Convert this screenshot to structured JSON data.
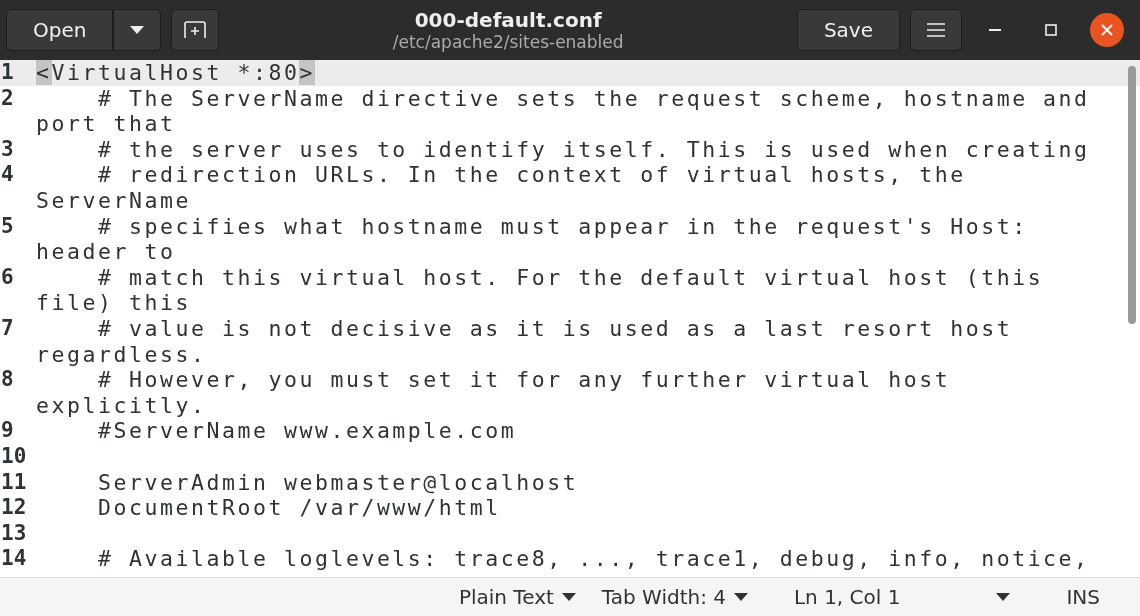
{
  "header_bar": {
    "open_button": "Open",
    "title": "000-default.conf",
    "subtitle": "/etc/apache2/sites-enabled",
    "save_button": "Save"
  },
  "editor": {
    "lines": [
      {
        "number": "1",
        "text": "<VirtualHost *:80>",
        "current": true,
        "bracket_match": true
      },
      {
        "number": "2",
        "text": "    # The ServerName directive sets the request scheme, hostname and port that",
        "current": false,
        "bracket_match": false
      },
      {
        "number": "3",
        "text": "    # the server uses to identify itself. This is used when creating",
        "current": false,
        "bracket_match": false
      },
      {
        "number": "4",
        "text": "    # redirection URLs. In the context of virtual hosts, the ServerName",
        "current": false,
        "bracket_match": false
      },
      {
        "number": "5",
        "text": "    # specifies what hostname must appear in the request's Host: header to",
        "current": false,
        "bracket_match": false
      },
      {
        "number": "6",
        "text": "    # match this virtual host. For the default virtual host (this file) this",
        "current": false,
        "bracket_match": false
      },
      {
        "number": "7",
        "text": "    # value is not decisive as it is used as a last resort host regardless.",
        "current": false,
        "bracket_match": false
      },
      {
        "number": "8",
        "text": "    # However, you must set it for any further virtual host explicitly.",
        "current": false,
        "bracket_match": false
      },
      {
        "number": "9",
        "text": "    #ServerName www.example.com",
        "current": false,
        "bracket_match": false
      },
      {
        "number": "10",
        "current": false
      },
      {
        "number": "11",
        "text": "    ServerAdmin webmaster@localhost",
        "current": false,
        "bracket_match": false
      },
      {
        "number": "12",
        "text": "    DocumentRoot /var/www/html",
        "current": false,
        "bracket_match": false
      },
      {
        "number": "13",
        "current": false
      },
      {
        "number": "14",
        "text": "    # Available loglevels: trace8, ..., trace1, debug, info, notice,",
        "current": false,
        "bracket_match": false
      }
    ]
  },
  "status_bar": {
    "language": "Plain Text",
    "tab_width": "Tab Width: 4",
    "position": "Ln 1, Col 1",
    "mode": "INS"
  }
}
